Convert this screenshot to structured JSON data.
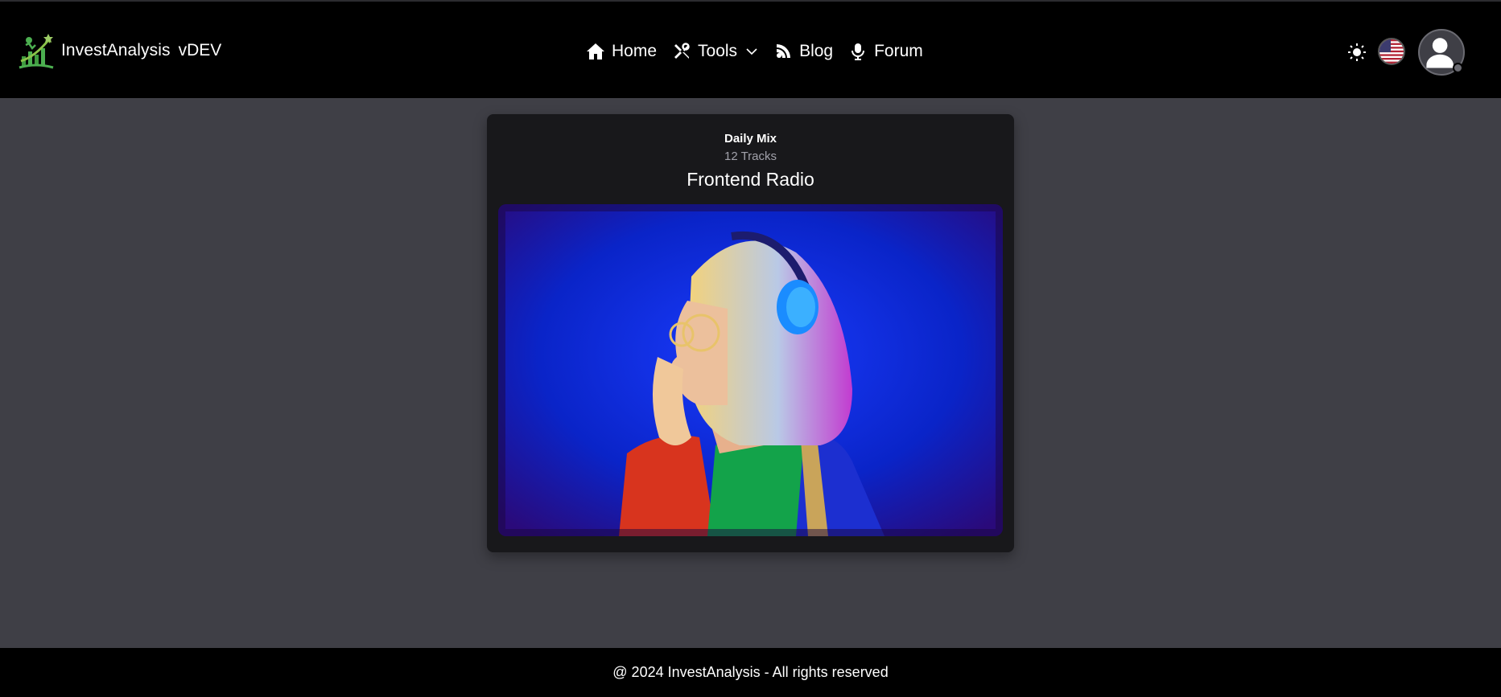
{
  "app": {
    "brand_name": "InvestAnalysis",
    "version": "vDEV",
    "logo_icon": "growth-chart-logo-icon"
  },
  "nav": {
    "items": [
      {
        "label": "Home",
        "icon": "home-icon"
      },
      {
        "label": "Tools",
        "icon": "tools-icon",
        "has_dropdown": true
      },
      {
        "label": "Blog",
        "icon": "rss-icon"
      },
      {
        "label": "Forum",
        "icon": "microphone-icon"
      }
    ]
  },
  "header_actions": {
    "theme_icon": "sun-icon",
    "language_flag": "us-flag-icon",
    "avatar_icon": "user-avatar-icon"
  },
  "card": {
    "subtitle": "Daily Mix",
    "track_count": "12 Tracks",
    "title": "Frontend Radio",
    "image_subject": "woman-with-headphones-photo"
  },
  "footer": {
    "text": "@ 2024 InvestAnalysis - All rights reserved"
  },
  "colors": {
    "page_bg": "#3f3f46",
    "header_bg": "#000000",
    "card_bg": "#18181b",
    "accent_green": "#4caf50",
    "muted_text": "#a1a1aa"
  }
}
